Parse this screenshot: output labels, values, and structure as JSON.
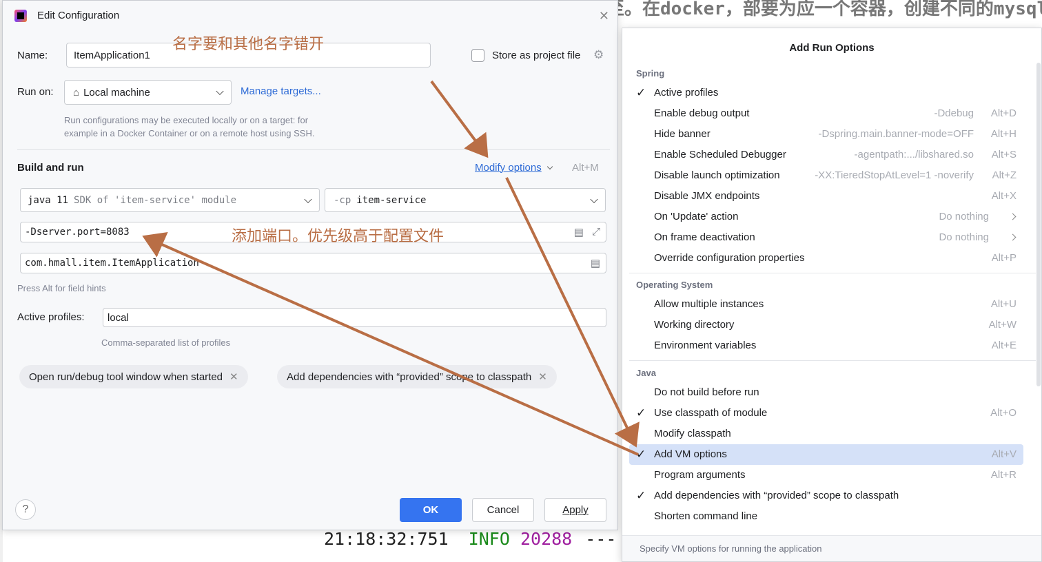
{
  "background": {
    "top_text": "至。在docker，部要为应一个容器，创建不同的mysql数据库",
    "log": {
      "time": "21:18:32:751",
      "level": "INFO",
      "pid": "20288",
      "sep": "---"
    }
  },
  "dialog": {
    "title": "Edit Configuration",
    "name_label": "Name:",
    "name_value": "ItemApplication1",
    "store_label": "Store as project file",
    "run_on_label": "Run on:",
    "run_on_value": "Local machine",
    "manage_targets": "Manage targets...",
    "run_on_hint_1": "Run configurations may be executed locally or on a target: for",
    "run_on_hint_2": "example in a Docker Container or on a remote host using SSH.",
    "build_run_title": "Build and run",
    "modify_options": "Modify options",
    "modify_shortcut": "Alt+M",
    "sdk_value": "java 11",
    "sdk_suffix": "SDK of 'item-service' module",
    "cp_prefix": "-cp",
    "cp_value": "item-service",
    "vm_options": "-Dserver.port=8083",
    "main_class": "com.hmall.item.ItemApplication",
    "field_hint": "Press Alt for field hints",
    "profiles_label": "Active profiles:",
    "profiles_value": "local",
    "profiles_hint": "Comma-separated list of profiles",
    "chip_1": "Open run/debug tool window when started",
    "chip_2": "Add dependencies with “provided” scope to classpath",
    "help": "?",
    "ok": "OK",
    "cancel": "Cancel",
    "apply": "Apply"
  },
  "annotations": {
    "name_note": "名字要和其他名字错开",
    "vm_note": "添加端口。优先级高于配置文件"
  },
  "popup": {
    "title": "Add Run Options",
    "footer": "Specify VM options for running the application",
    "groups": {
      "spring": "Spring",
      "os": "Operating System",
      "java": "Java"
    },
    "spring_items": [
      {
        "label": "Active profiles",
        "checked": "✓",
        "hint": "",
        "key": ""
      },
      {
        "label": "Enable debug output",
        "checked": "",
        "hint": "-Ddebug",
        "key": "Alt+D"
      },
      {
        "label": "Hide banner",
        "checked": "",
        "hint": "-Dspring.main.banner-mode=OFF",
        "key": "Alt+H"
      },
      {
        "label": "Enable Scheduled Debugger",
        "checked": "",
        "hint": "-agentpath:.../libshared.so",
        "key": "Alt+S"
      },
      {
        "label": "Disable launch optimization",
        "checked": "",
        "hint": "-XX:TieredStopAtLevel=1 -noverify",
        "key": "Alt+Z"
      },
      {
        "label": "Disable JMX endpoints",
        "checked": "",
        "hint": "",
        "key": "Alt+X"
      },
      {
        "label": "On 'Update' action",
        "checked": "",
        "hint": "Do nothing",
        "key": ""
      },
      {
        "label": "On frame deactivation",
        "checked": "",
        "hint": "Do nothing",
        "key": ""
      },
      {
        "label": "Override configuration properties",
        "checked": "",
        "hint": "",
        "key": "Alt+P"
      }
    ],
    "os_items": [
      {
        "label": "Allow multiple instances",
        "checked": "",
        "key": "Alt+U"
      },
      {
        "label": "Working directory",
        "checked": "",
        "key": "Alt+W"
      },
      {
        "label": "Environment variables",
        "checked": "",
        "key": "Alt+E"
      }
    ],
    "java_items": [
      {
        "label": "Do not build before run",
        "checked": "",
        "key": ""
      },
      {
        "label": "Use classpath of module",
        "checked": "✓",
        "key": "Alt+O"
      },
      {
        "label": "Modify classpath",
        "checked": "",
        "key": ""
      },
      {
        "label": "Add VM options",
        "checked": "✓",
        "key": "Alt+V"
      },
      {
        "label": "Program arguments",
        "checked": "",
        "key": "Alt+R"
      },
      {
        "label": "Add dependencies with “provided” scope to classpath",
        "checked": "✓",
        "key": ""
      },
      {
        "label": "Shorten command line",
        "checked": "",
        "key": ""
      }
    ]
  },
  "colors": {
    "accent": "#3574f0",
    "annotation": "#b96e45",
    "selection": "#d5e1f8"
  }
}
